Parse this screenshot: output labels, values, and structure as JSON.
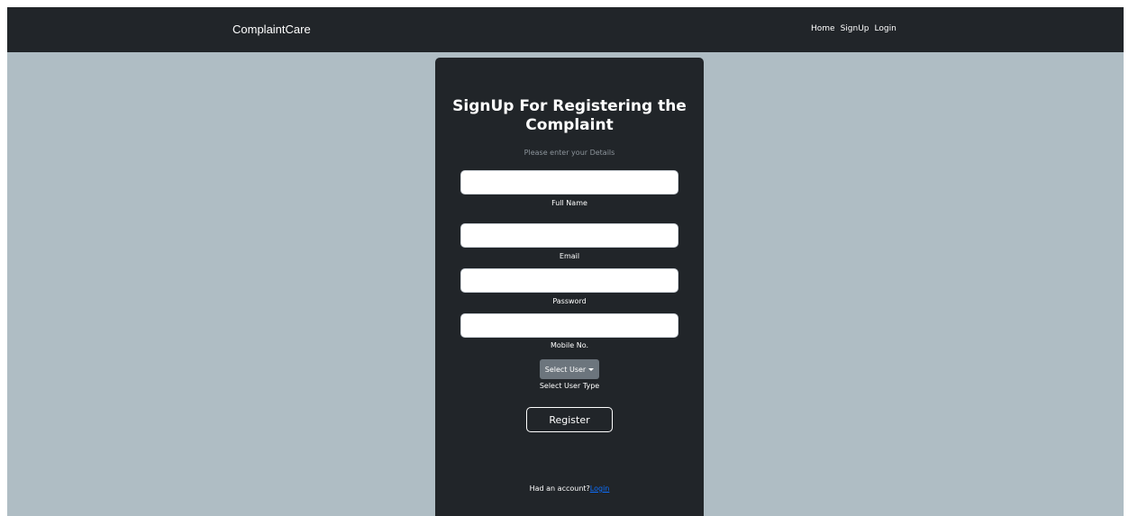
{
  "navbar": {
    "brand": "ComplaintCare",
    "links": [
      "Home",
      "SignUp",
      "Login"
    ]
  },
  "form": {
    "title": "SignUp For Registering the Complaint",
    "subtitle": "Please enter your Details",
    "fields": [
      {
        "label": "Full Name",
        "value": "",
        "placeholder": ""
      },
      {
        "label": "Email",
        "value": "",
        "placeholder": ""
      },
      {
        "label": "Password",
        "value": "",
        "placeholder": ""
      },
      {
        "label": "Mobile No.",
        "value": "",
        "placeholder": ""
      }
    ],
    "user_type": {
      "button_label": "Select User",
      "label": "Select User Type"
    },
    "register_label": "Register",
    "account_prompt": "Had an account?",
    "login_link": "Login"
  },
  "colors": {
    "navbar_bg": "#212529",
    "page_bg": "#afbdc4",
    "card_bg": "#212529",
    "link": "#0d6efd",
    "dropdown_bg": "#6c757d"
  }
}
